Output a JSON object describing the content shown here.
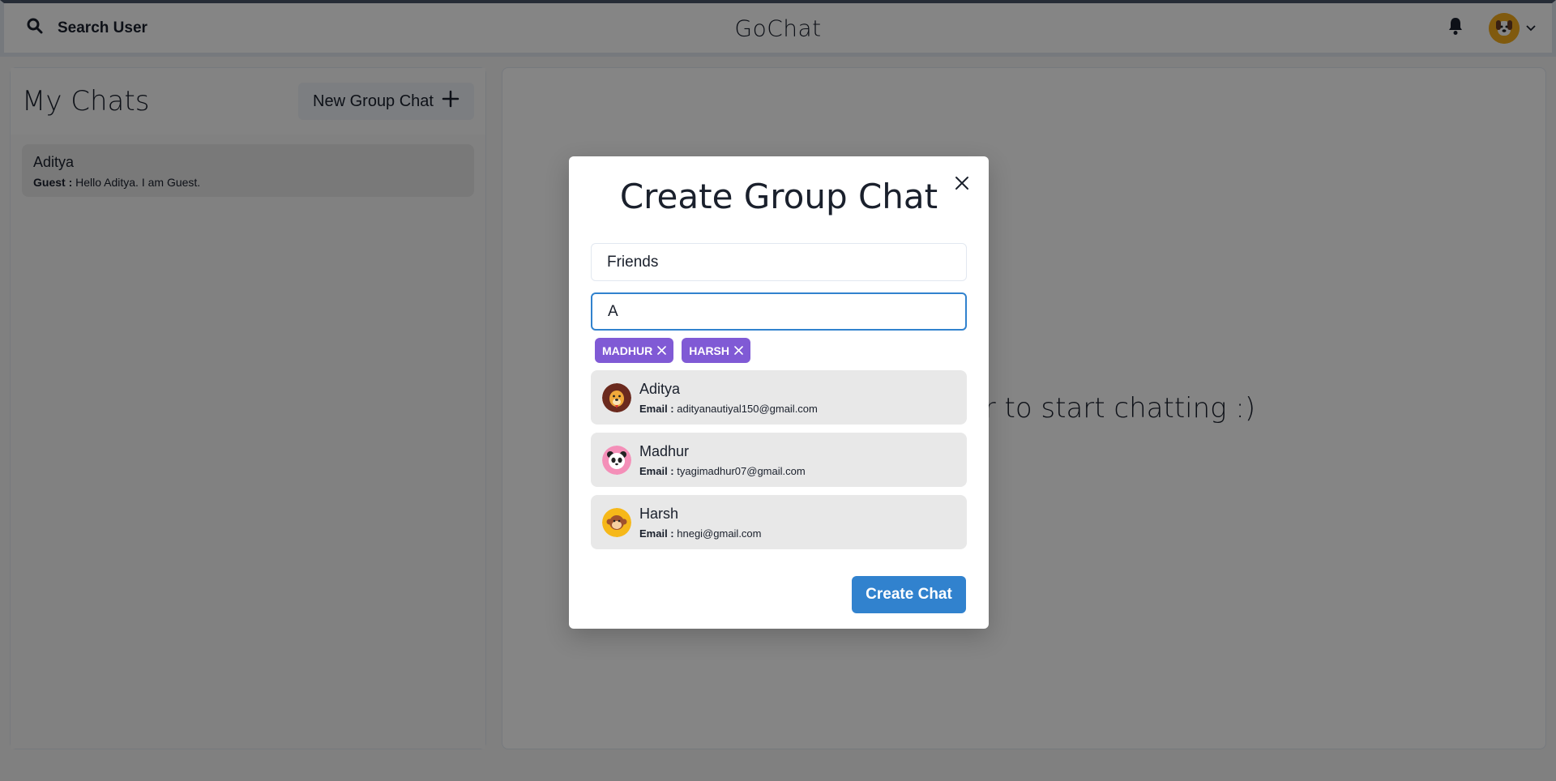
{
  "header": {
    "search_label": "Search User",
    "brand": "GoChat",
    "icons": [
      "search-icon",
      "bell-icon",
      "chevron-down-icon"
    ]
  },
  "chats": {
    "title": "My Chats",
    "new_group_label": "New Group Chat",
    "items": [
      {
        "name": "Aditya",
        "sender": "Guest :",
        "message": "Hello Aditya. I am Guest."
      }
    ]
  },
  "main": {
    "empty_text": "Click on a user to start chatting :)"
  },
  "modal": {
    "title": "Create Group Chat",
    "chat_name_value": "Friends",
    "search_value": "A",
    "selected_users": [
      "MADHUR",
      "HARSH"
    ],
    "results": [
      {
        "name": "Aditya",
        "email_label": "Email :",
        "email": "adityanautiyal150@gmail.com",
        "avatar": "dog-avatar"
      },
      {
        "name": "Madhur",
        "email_label": "Email :",
        "email": "tyagimadhur07@gmail.com",
        "avatar": "panda-avatar"
      },
      {
        "name": "Harsh",
        "email_label": "Email :",
        "email": "hnegi@gmail.com",
        "avatar": "monkey-avatar"
      }
    ],
    "create_label": "Create Chat"
  },
  "colors": {
    "accent": "#3182ce",
    "tag": "#805ad5",
    "overlay": "rgba(0,0,0,0.48)"
  }
}
